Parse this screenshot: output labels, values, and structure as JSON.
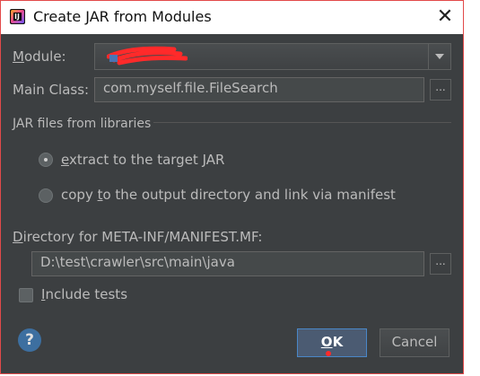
{
  "window": {
    "title": "Create JAR from Modules",
    "icon": "intellij-idea-icon",
    "close_glyph": "✕"
  },
  "module": {
    "label_mnemonic": "M",
    "label_rest": "odule:",
    "value": ""
  },
  "main_class": {
    "label": "Main Class:",
    "value": "com.myself.file.FileSearch",
    "browse_glyph": "..."
  },
  "jar_files": {
    "section_title": "JAR files from libraries",
    "options": [
      {
        "pre": "",
        "mnemonic": "e",
        "post": "xtract to the target JAR",
        "selected": true
      },
      {
        "pre": "copy ",
        "mnemonic": "t",
        "post": "o the output directory and link via manifest",
        "selected": false
      }
    ]
  },
  "manifest": {
    "label_mnemonic": "D",
    "label_rest": "irectory for META-INF/MANIFEST.MF:",
    "value": "D:\\test\\crawler\\src\\main\\java",
    "browse_glyph": "..."
  },
  "include_tests": {
    "mnemonic": "I",
    "rest": "nclude tests",
    "checked": false
  },
  "help": {
    "glyph": "?"
  },
  "buttons": {
    "ok": {
      "mnemonic": "O",
      "rest": "K"
    },
    "cancel": "Cancel"
  },
  "colors": {
    "dialog_bg": "#3c3f41",
    "text": "#bbbbbb",
    "ok_border": "#4a87c7",
    "annotation_red": "#ff2a2a"
  }
}
